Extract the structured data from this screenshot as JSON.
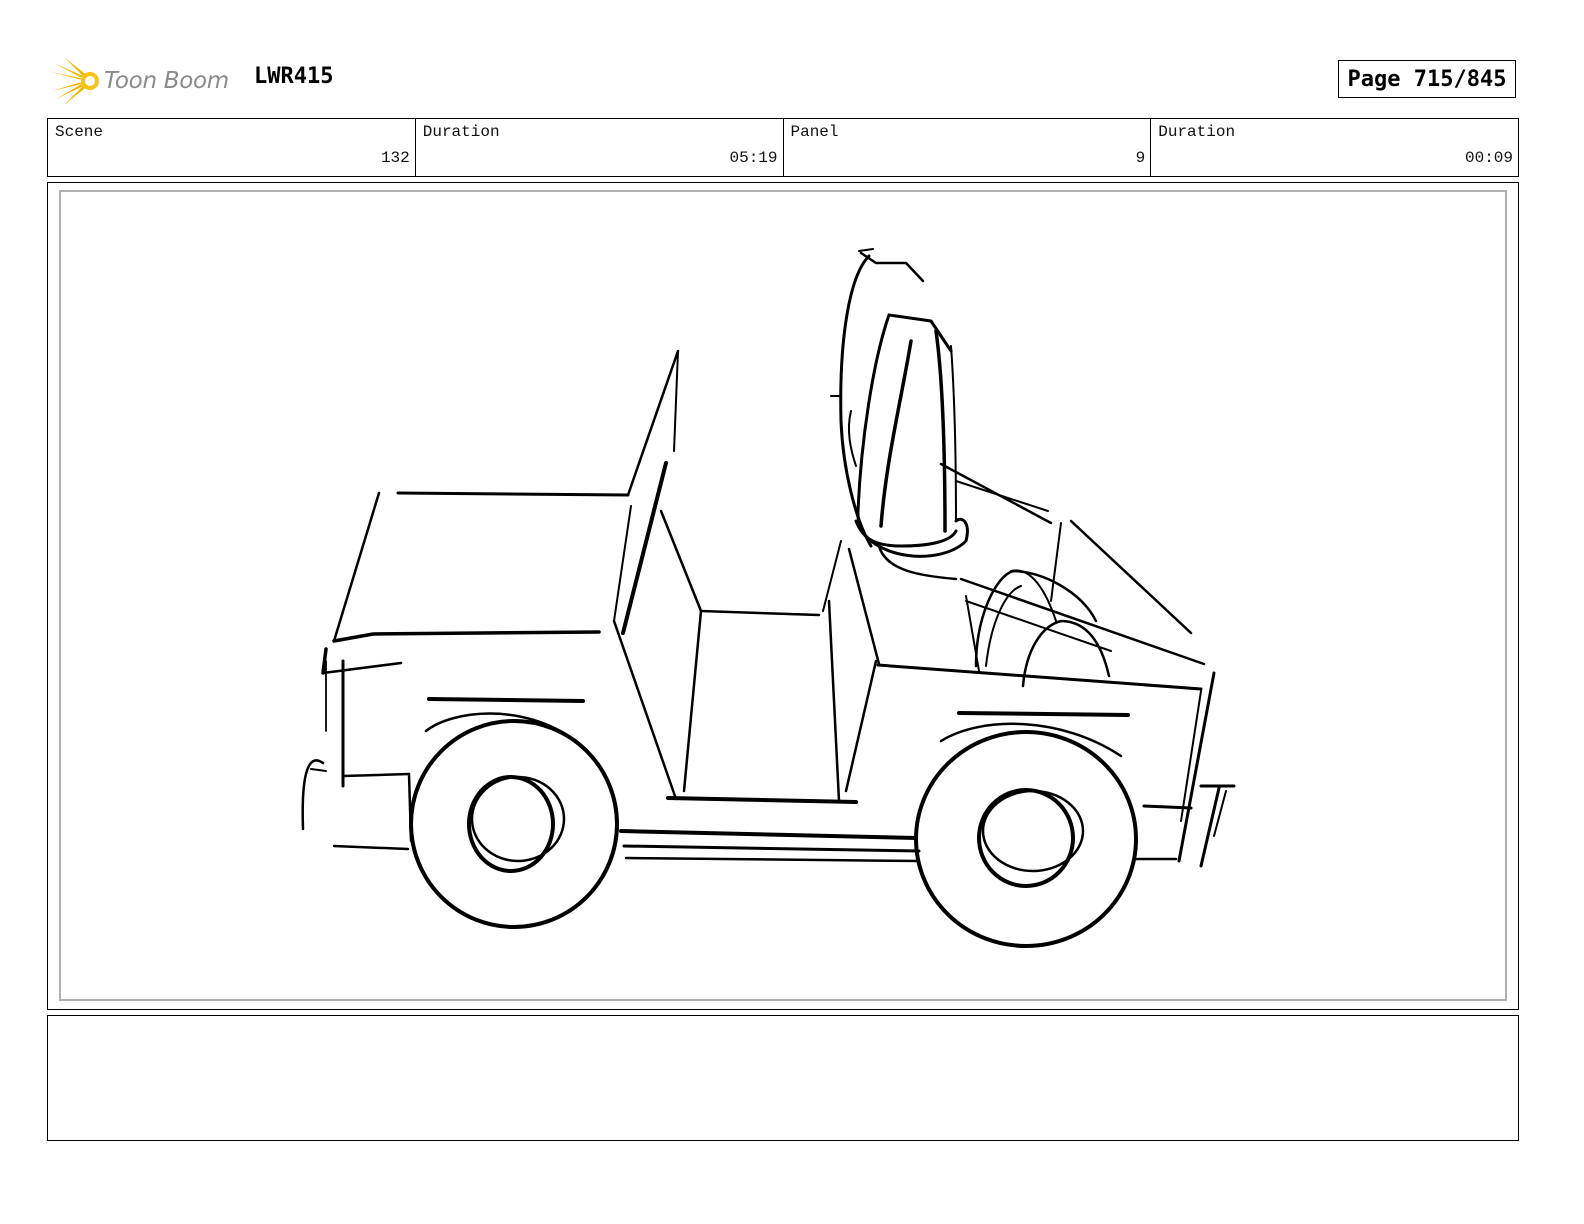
{
  "header": {
    "brand": "Toon Boom",
    "brand_icon": "sun-burst-logo",
    "brand_color": "#f2b400",
    "project": "LWR415",
    "page": "Page 715/845"
  },
  "info": {
    "scene_label": "Scene",
    "scene_value": "132",
    "scene_duration_label": "Duration",
    "scene_duration_value": "05:19",
    "panel_label": "Panel",
    "panel_value": "9",
    "panel_duration_label": "Duration",
    "panel_duration_value": "00:09"
  },
  "panel": {
    "drawing": "jeep-sketch"
  },
  "notes": {
    "text": ""
  }
}
